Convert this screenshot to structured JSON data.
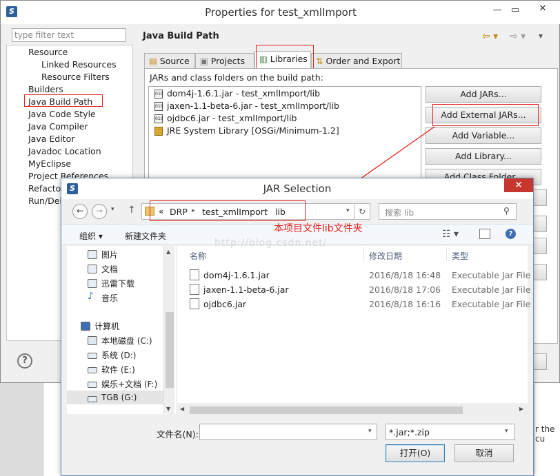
{
  "properties_dialog": {
    "title": "Properties for test_xmlImport",
    "filter_placeholder": "type filter text",
    "page_title": "Java Build Path",
    "nav_items": [
      "Resource",
      "Linked Resources",
      "Resource Filters",
      "Builders",
      "Java Build Path",
      "Java Code Style",
      "Java Compiler",
      "Java Editor",
      "Javadoc Location",
      "MyEclipse",
      "Project References",
      "Refactor",
      "Run/Deb"
    ],
    "tabs": [
      "Source",
      "Projects",
      "Libraries",
      "Order and Export"
    ],
    "jar_caption": "JARs and class folders on the build path:",
    "jars": [
      "dom4j-1.6.1.jar - test_xmlImport/lib",
      "jaxen-1.1-beta-6.jar - test_xmlImport/lib",
      "ojdbc6.jar - test_xmlImport/lib",
      "JRE System Library [OSGi/Minimum-1.2]"
    ],
    "buttons": [
      "Add JARs...",
      "Add External JARs...",
      "Add Variable...",
      "Add Library...",
      "Add Class Folder..."
    ],
    "help_icon_label": "?"
  },
  "jar_dialog": {
    "title": "JAR Selection",
    "close_glyph": "✕",
    "breadcrumb": [
      "«",
      "DRP",
      "▸",
      "test_xmlImport",
      "▸",
      "lib"
    ],
    "search_placeholder": "搜索 lib",
    "annotation": "本项目文件lib文件夹",
    "organize_label": "组织 ▾",
    "new_folder_label": "新建文件夹",
    "side_items": [
      "图片",
      "文档",
      "迅雷下载",
      "音乐",
      "计算机",
      "本地磁盘 (C:)",
      "系统 (D:)",
      "软件 (E:)",
      "娱乐+文档 (F:)",
      "TGB (G:)"
    ],
    "columns": [
      "名称",
      "修改日期",
      "类型"
    ],
    "files": [
      {
        "name": "dom4j-1.6.1.jar",
        "date": "2016/8/18 16:48",
        "type": "Executable Jar File"
      },
      {
        "name": "jaxen-1.1-beta-6.jar",
        "date": "2016/8/18 17:06",
        "type": "Executable Jar File"
      },
      {
        "name": "ojdbc6.jar",
        "date": "2016/8/18 16:16",
        "type": "Executable Jar File"
      }
    ],
    "filename_label": "文件名(N):",
    "filename_value": "",
    "filetype_value": "*.jar;*.zip",
    "open_label": "打开(O)",
    "cancel_label": "取消",
    "watermark": "http://blog.csdn.net/"
  },
  "background_fragment": "r the cu",
  "colors": {
    "annotation_red": "#e8201a",
    "dialog_border": "#6d8fb8",
    "close_red": "#c7372f"
  }
}
